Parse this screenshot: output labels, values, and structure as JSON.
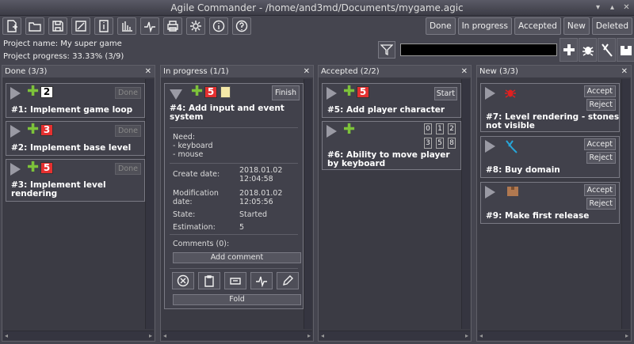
{
  "window": {
    "title": "Agile Commander - /home/and3md/Documents/mygame.agic"
  },
  "toolbar": {
    "icons": [
      "new-file-icon",
      "open-folder-icon",
      "save-icon",
      "statistics-edit-icon",
      "info-doc-icon",
      "bar-chart-icon",
      "activity-icon",
      "print-icon",
      "settings-icon",
      "info-icon",
      "help-icon"
    ]
  },
  "project": {
    "name": "Project name: My super game",
    "progress": "Project progress: 33.33% (3/9)"
  },
  "filters": [
    "Done",
    "In progress",
    "Accepted",
    "New",
    "Deleted"
  ],
  "columns": [
    {
      "title": "Done (3/3)",
      "cards": [
        {
          "title": "#1: Implement game loop",
          "estimate": "2",
          "button": "Done"
        },
        {
          "title": "#2: Implement base level",
          "estimate": "3",
          "button": "Done"
        },
        {
          "title": "#3: Implement level rendering",
          "estimate": "5",
          "button": "Done"
        }
      ]
    },
    {
      "title": "In progress (1/1)",
      "card": {
        "title": "#4: Add input and event system",
        "estimate": "5",
        "button": "Finish",
        "need_label": "Need:",
        "need_items": [
          "- keyboard",
          "- mouse"
        ],
        "create_label": "Create date:",
        "create_value": "2018.01.02 12:04:58",
        "mod_label": "Modification date:",
        "mod_value": "2018.01.02 12:05:56",
        "state_label": "State:",
        "state_value": "Started",
        "est_label": "Estimation:",
        "est_value": "5",
        "comments": "Comments (0):",
        "add_comment": "Add comment",
        "fold": "Fold"
      }
    },
    {
      "title": "Accepted (2/2)",
      "cards": [
        {
          "title": "#5: Add player character",
          "estimate": "5",
          "button": "Start"
        },
        {
          "title": "#6: Ability to move player by keyboard",
          "estimate": "",
          "digits": [
            "0",
            "1",
            "2",
            "3",
            "5",
            "8"
          ]
        }
      ]
    },
    {
      "title": "New (3/3)",
      "cards": [
        {
          "title": "#7: Level rendering - stones not visible",
          "icon": "bug-icon",
          "accept": "Accept",
          "reject": "Reject"
        },
        {
          "title": "#8: Buy domain",
          "icon": "pliers-icon",
          "accept": "Accept",
          "reject": "Reject"
        },
        {
          "title": "#9: Make first release",
          "icon": "box-icon",
          "accept": "Accept",
          "reject": "Reject"
        }
      ]
    }
  ],
  "colors": {
    "background": "#45454f",
    "panel": "#3b3b44",
    "plus": "#7dc33a",
    "badge_red": "#e53030"
  }
}
